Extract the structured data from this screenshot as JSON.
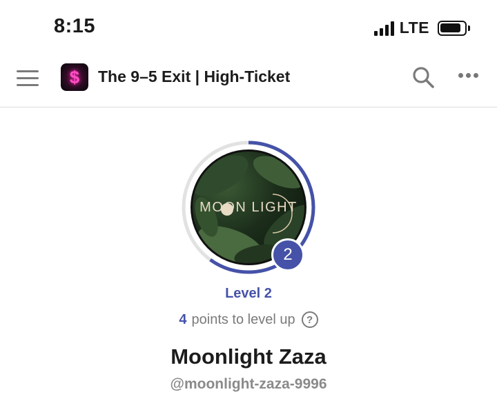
{
  "status_bar": {
    "time": "8:15",
    "network": "LTE",
    "icons": [
      "signal-icon",
      "battery-icon"
    ]
  },
  "header": {
    "title": "The 9–5 Exit | High-Ticket",
    "logo_glyph": "$",
    "icons": [
      "menu-icon",
      "search-icon",
      "more-icon"
    ]
  },
  "profile": {
    "avatar_text": "MOON LIGHT",
    "level_badge": "2",
    "level_label": "Level 2",
    "level_progress": 0.6,
    "points_number": "4",
    "points_text": "points to level up",
    "help_glyph": "?",
    "name": "Moonlight Zaza",
    "handle": "@moonlight-zaza-9996"
  },
  "colors": {
    "accent": "#4552a8",
    "ring_track": "#e2e2e2",
    "muted_text": "#7a7a7a"
  }
}
